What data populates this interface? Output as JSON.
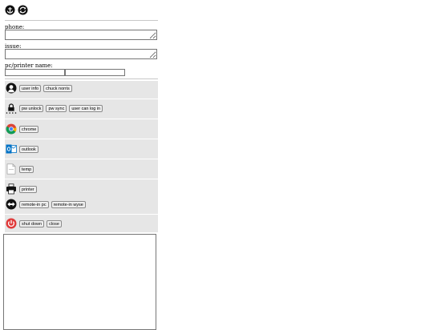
{
  "form": {
    "phone_label": "phone:",
    "issue_label": "issue:",
    "pc_label": "pc/printer name:"
  },
  "sections": {
    "user": {
      "user_info": "user info",
      "chuck_norris": "chuck norris"
    },
    "password": {
      "pw_unlock": "pw unlock",
      "pw_sync": "pw sync",
      "user_can_log_in": "user can log in"
    },
    "chrome": {
      "label": "chrome"
    },
    "outlook": {
      "label": "outlook"
    },
    "temp": {
      "label": "temp"
    },
    "printer": {
      "label": "printer"
    },
    "remote": {
      "remote_in_pc": "remote-in pc",
      "remote_in_wyse": "remote-in wyse"
    },
    "power": {
      "shut_down": "shut down",
      "close": "close"
    }
  },
  "icons": {
    "top": [
      "anchor-icon",
      "refresh-icon"
    ],
    "power_color": "#e03a3a",
    "outlook_color": "#0072c6"
  }
}
